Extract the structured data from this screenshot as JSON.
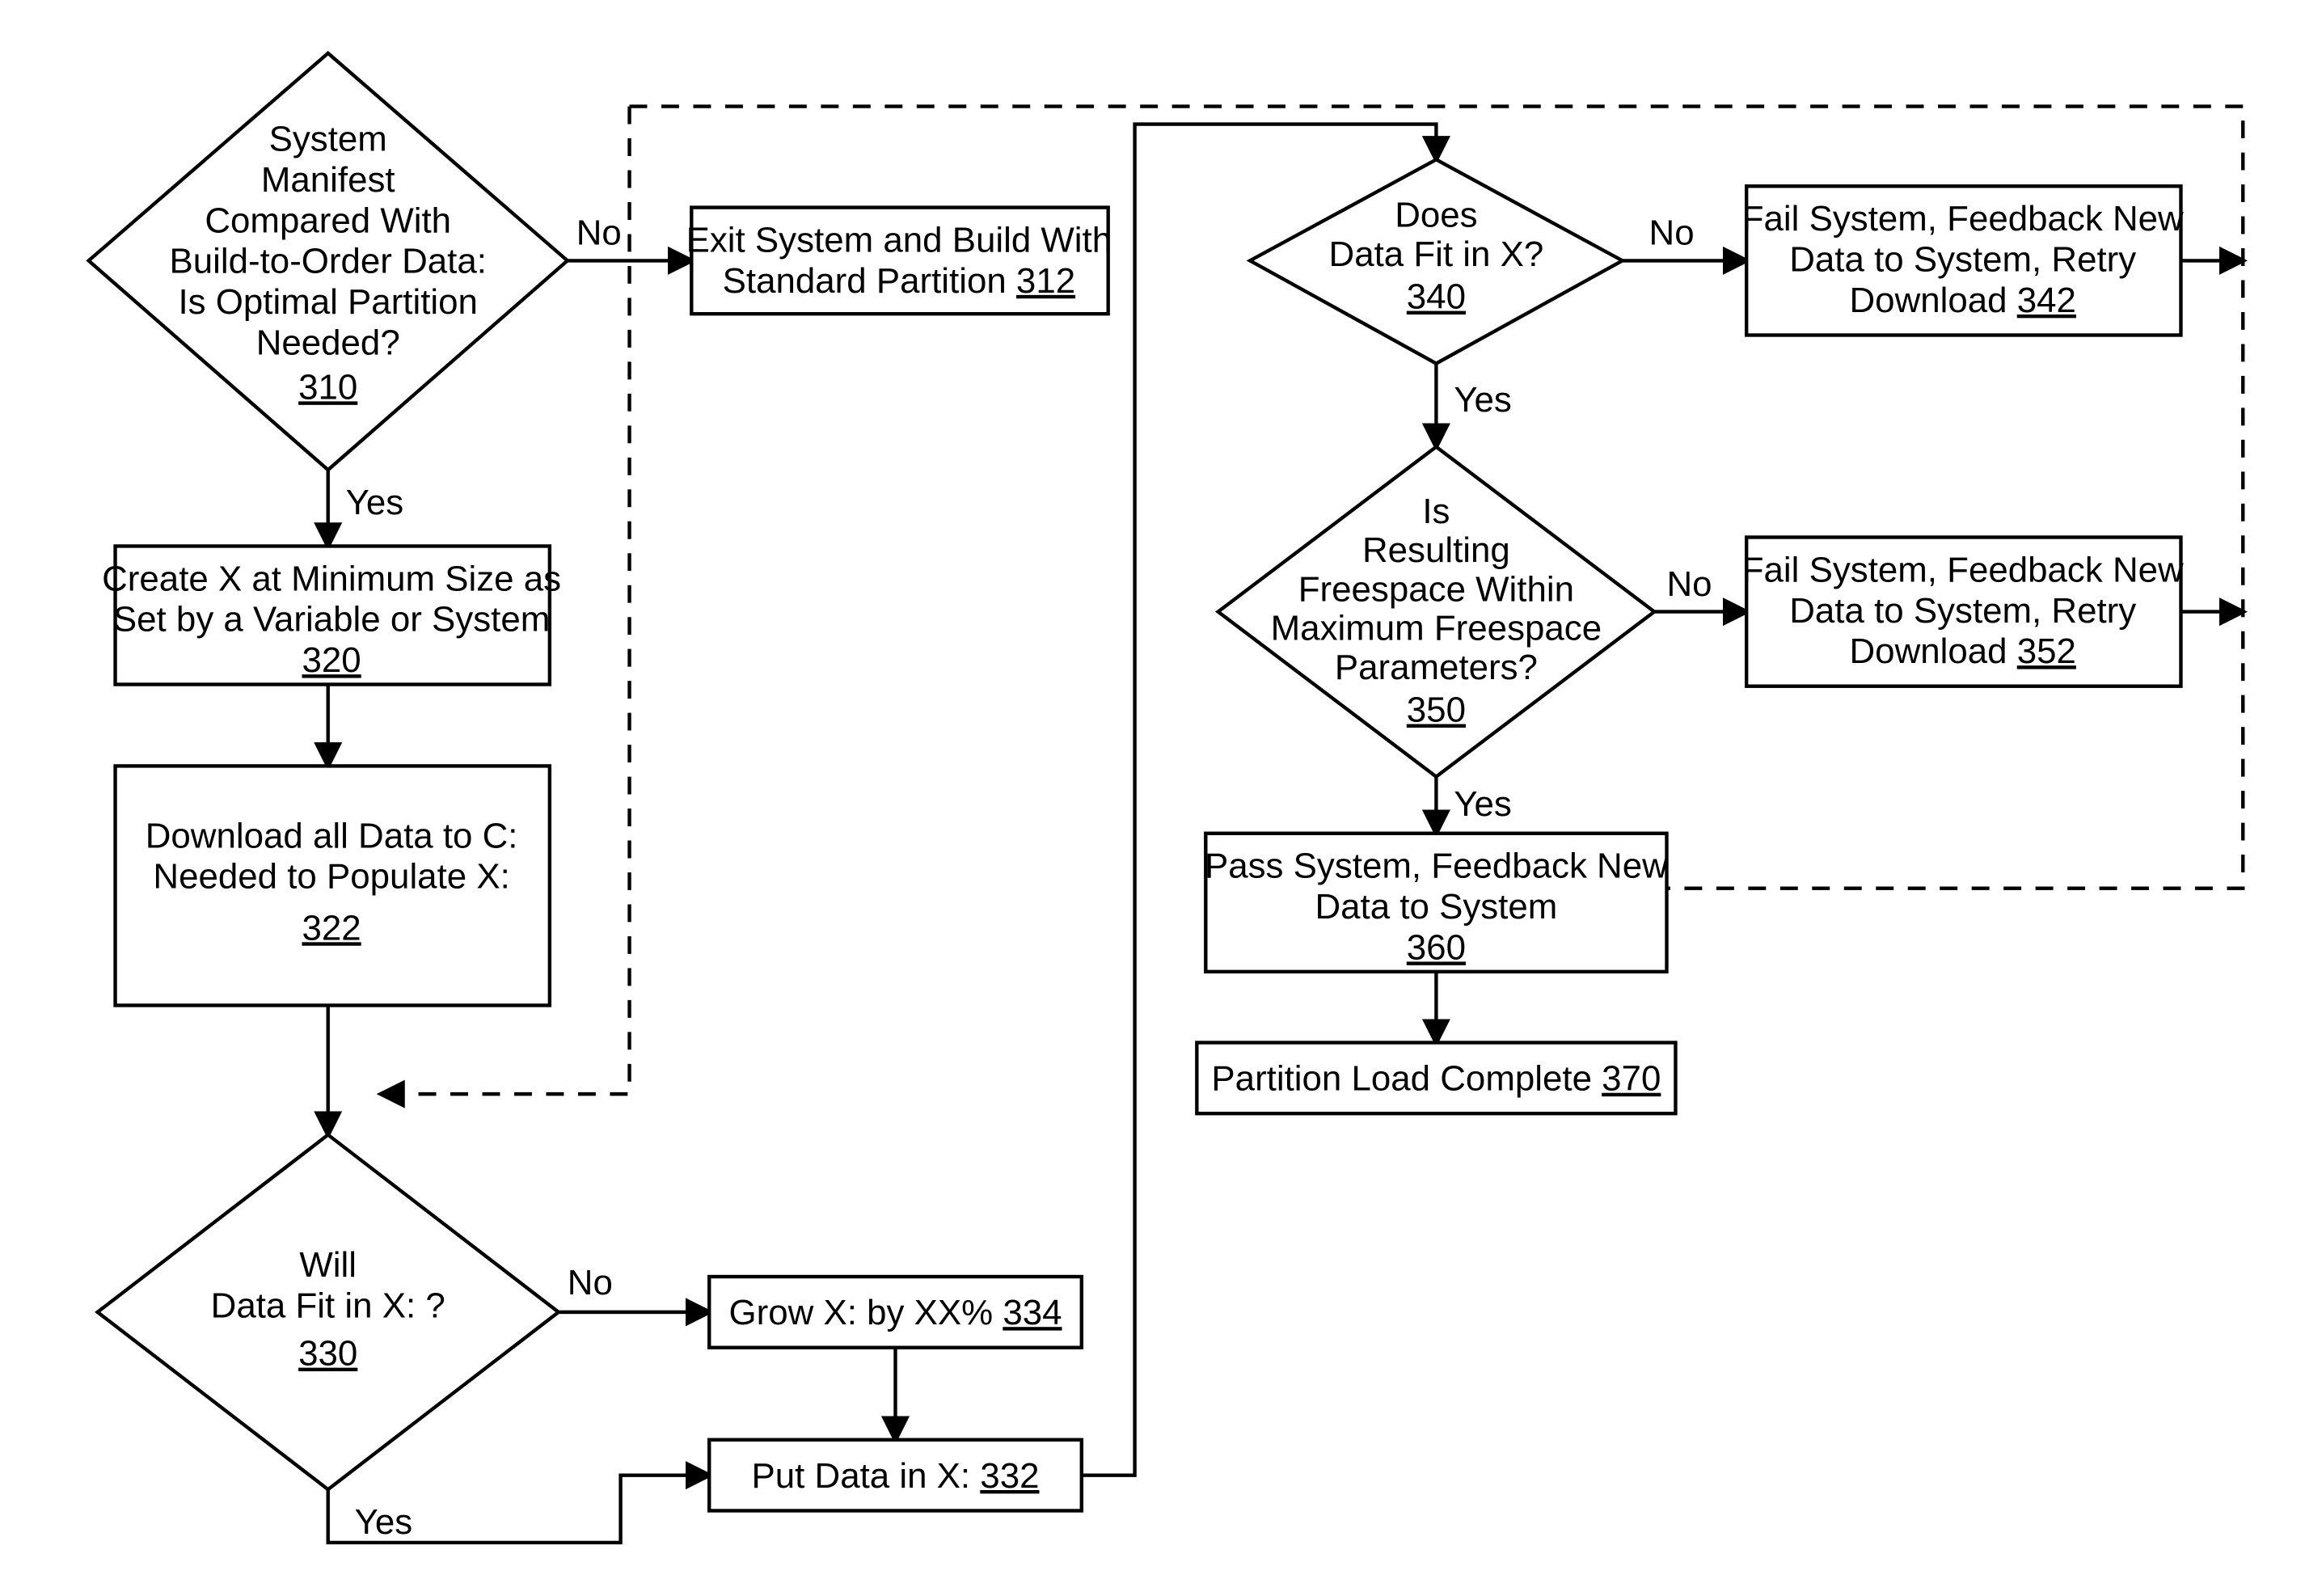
{
  "nodes": {
    "n310": {
      "lines": [
        "System",
        "Manifest",
        "Compared With",
        "Build-to-Order Data:",
        "Is Optimal Partition",
        "Needed?"
      ],
      "ref": "310"
    },
    "n312": {
      "lines": [
        "Exit System and Build With",
        "Standard Partition"
      ],
      "ref": "312"
    },
    "n320": {
      "lines": [
        "Create X at Minimum Size as",
        "Set  by a Variable or System"
      ],
      "ref": "320"
    },
    "n322": {
      "lines": [
        "Download all Data to C:",
        "Needed to Populate X:"
      ],
      "ref": "322"
    },
    "n330": {
      "lines": [
        "Will",
        "Data Fit in X: ?"
      ],
      "ref": "330"
    },
    "n332": {
      "text": "Put Data in X:",
      "ref": "332"
    },
    "n334": {
      "text": "Grow X: by XX%",
      "ref": "334"
    },
    "n340": {
      "lines": [
        "Does",
        "Data Fit in X?"
      ],
      "ref": "340"
    },
    "n342": {
      "lines": [
        "Fail System, Feedback New",
        "Data to System, Retry",
        "Download"
      ],
      "ref": "342"
    },
    "n350": {
      "lines": [
        "Is",
        "Resulting",
        "Freespace Within",
        "Maximum Freespace",
        "Parameters?"
      ],
      "ref": "350"
    },
    "n352": {
      "lines": [
        "Fail System, Feedback New",
        "Data to System, Retry",
        "Download"
      ],
      "ref": "352"
    },
    "n360": {
      "lines": [
        "Pass System, Feedback New",
        "Data to System"
      ],
      "ref": "360"
    },
    "n370": {
      "text": "Partition Load Complete",
      "ref": "370"
    }
  },
  "edges": {
    "yes": "Yes",
    "no": "No"
  }
}
